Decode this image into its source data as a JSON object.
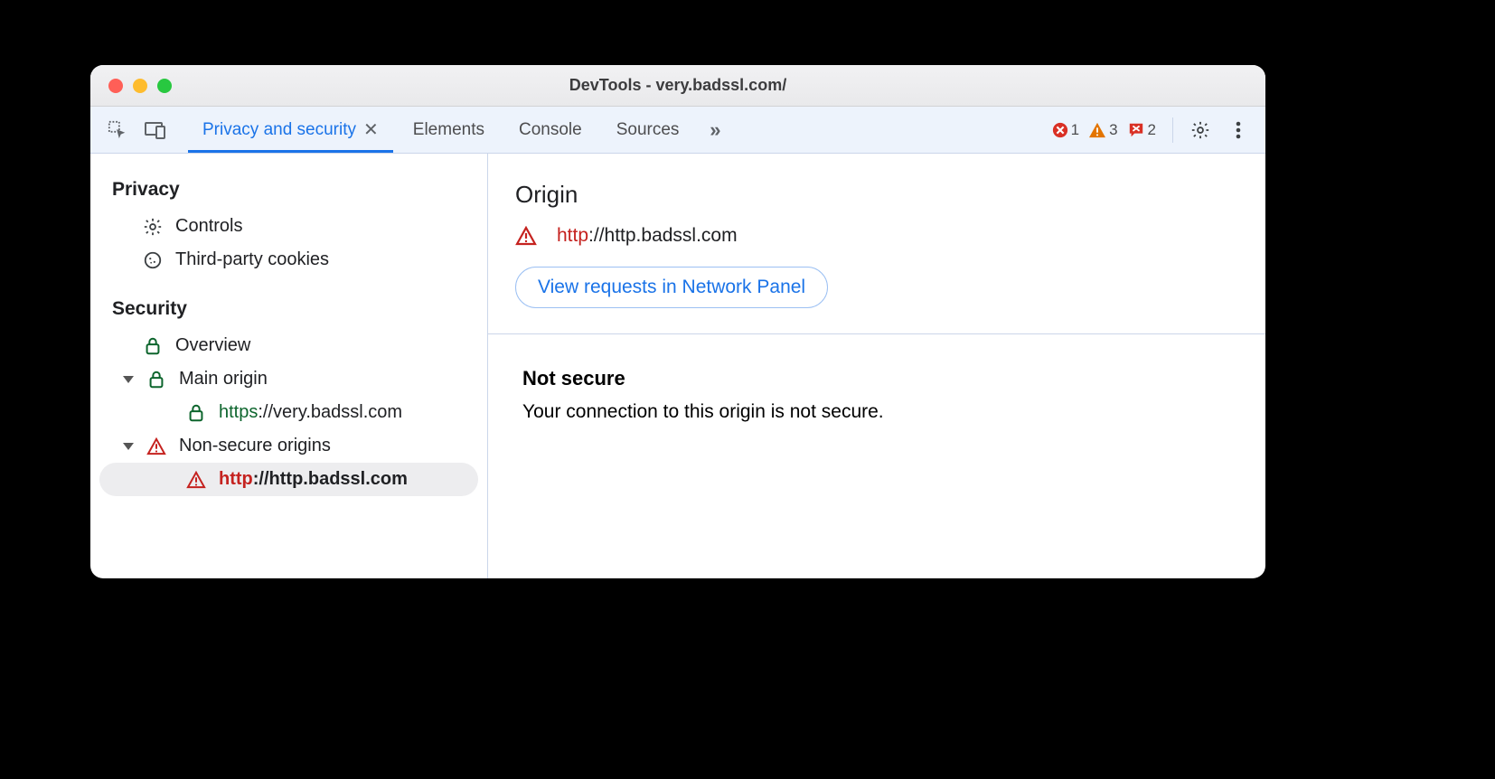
{
  "window": {
    "title": "DevTools - very.badssl.com/"
  },
  "tabs": {
    "active": "Privacy and security",
    "others": [
      "Elements",
      "Console",
      "Sources"
    ]
  },
  "status": {
    "errors": "1",
    "warnings": "3",
    "messages": "2"
  },
  "sidebar": {
    "privacy_header": "Privacy",
    "controls": "Controls",
    "cookies": "Third-party cookies",
    "security_header": "Security",
    "overview": "Overview",
    "main_origin": "Main origin",
    "main_origin_url_scheme": "https",
    "main_origin_url_rest": "://very.badssl.com",
    "nonsecure": "Non-secure origins",
    "nonsecure_item_scheme": "http",
    "nonsecure_item_rest": "://http.badssl.com"
  },
  "main": {
    "origin_title": "Origin",
    "origin_scheme": "http",
    "origin_rest": "://http.badssl.com",
    "view_requests_label": "View requests in Network Panel",
    "not_secure_head": "Not secure",
    "not_secure_body": "Your connection to this origin is not secure."
  }
}
